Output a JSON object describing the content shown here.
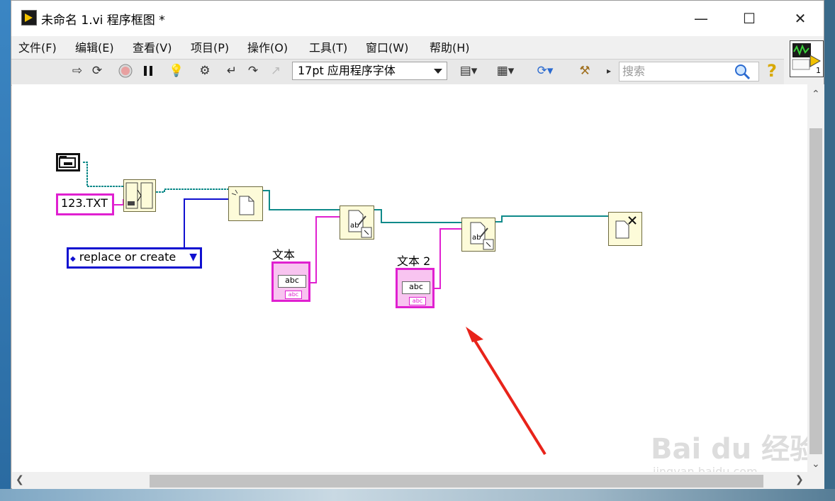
{
  "window": {
    "title": "未命名 1.vi 程序框图 *"
  },
  "menu": [
    "文件(F)",
    "编辑(E)",
    "查看(V)",
    "项目(P)",
    "操作(O)",
    "工具(T)",
    "窗口(W)",
    "帮助(H)"
  ],
  "toolbar": {
    "font": "17pt 应用程序字体",
    "search_placeholder": "搜索"
  },
  "connector_number": "1",
  "diagram": {
    "file_name_constant": "123.TXT",
    "operation_enum": "replace or create",
    "text1_label": "文本",
    "text2_label": "文本 2",
    "control_inner": "abc",
    "control_tag": "abc"
  },
  "watermark": {
    "brand": "Bai du 经验",
    "url": "jingyan.baidu.com"
  },
  "colors": {
    "string_wire": "#e020d0",
    "refnum_wire": "#0f8a8a",
    "enum_wire": "#1010d0",
    "node_fill": "#fdfbd9",
    "arrow": "#e8231a"
  }
}
